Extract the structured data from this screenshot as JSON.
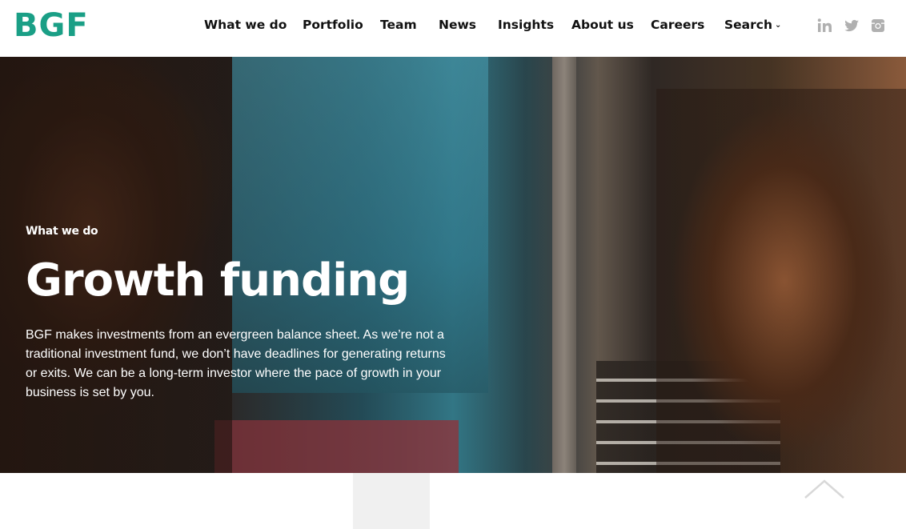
{
  "header": {
    "logo": "BGF",
    "nav": [
      {
        "label": "What we do"
      },
      {
        "label": "Portfolio"
      },
      {
        "label": "Team"
      },
      {
        "label": "News"
      },
      {
        "label": "Insights"
      },
      {
        "label": "About us"
      },
      {
        "label": "Careers"
      },
      {
        "label": "Search",
        "has_dropdown": true
      }
    ],
    "social": [
      "linkedin-icon",
      "twitter-icon",
      "instagram-icon"
    ]
  },
  "hero": {
    "eyebrow": "What we do",
    "title": "Growth funding",
    "body": "BGF makes investments from an evergreen balance sheet. As we’re not a traditional investment fund, we don’t have deadlines for generating returns or exits. We can be a long-term investor where the pace of growth in your business is set by you."
  },
  "colors": {
    "brand": "#1a9f86",
    "nav_text": "#111111",
    "hero_text": "#ffffff",
    "social_icon": "#b0b0b0"
  },
  "icons": {
    "search_caret": "chevron-down-icon",
    "scroll_top": "chevron-up-icon"
  }
}
